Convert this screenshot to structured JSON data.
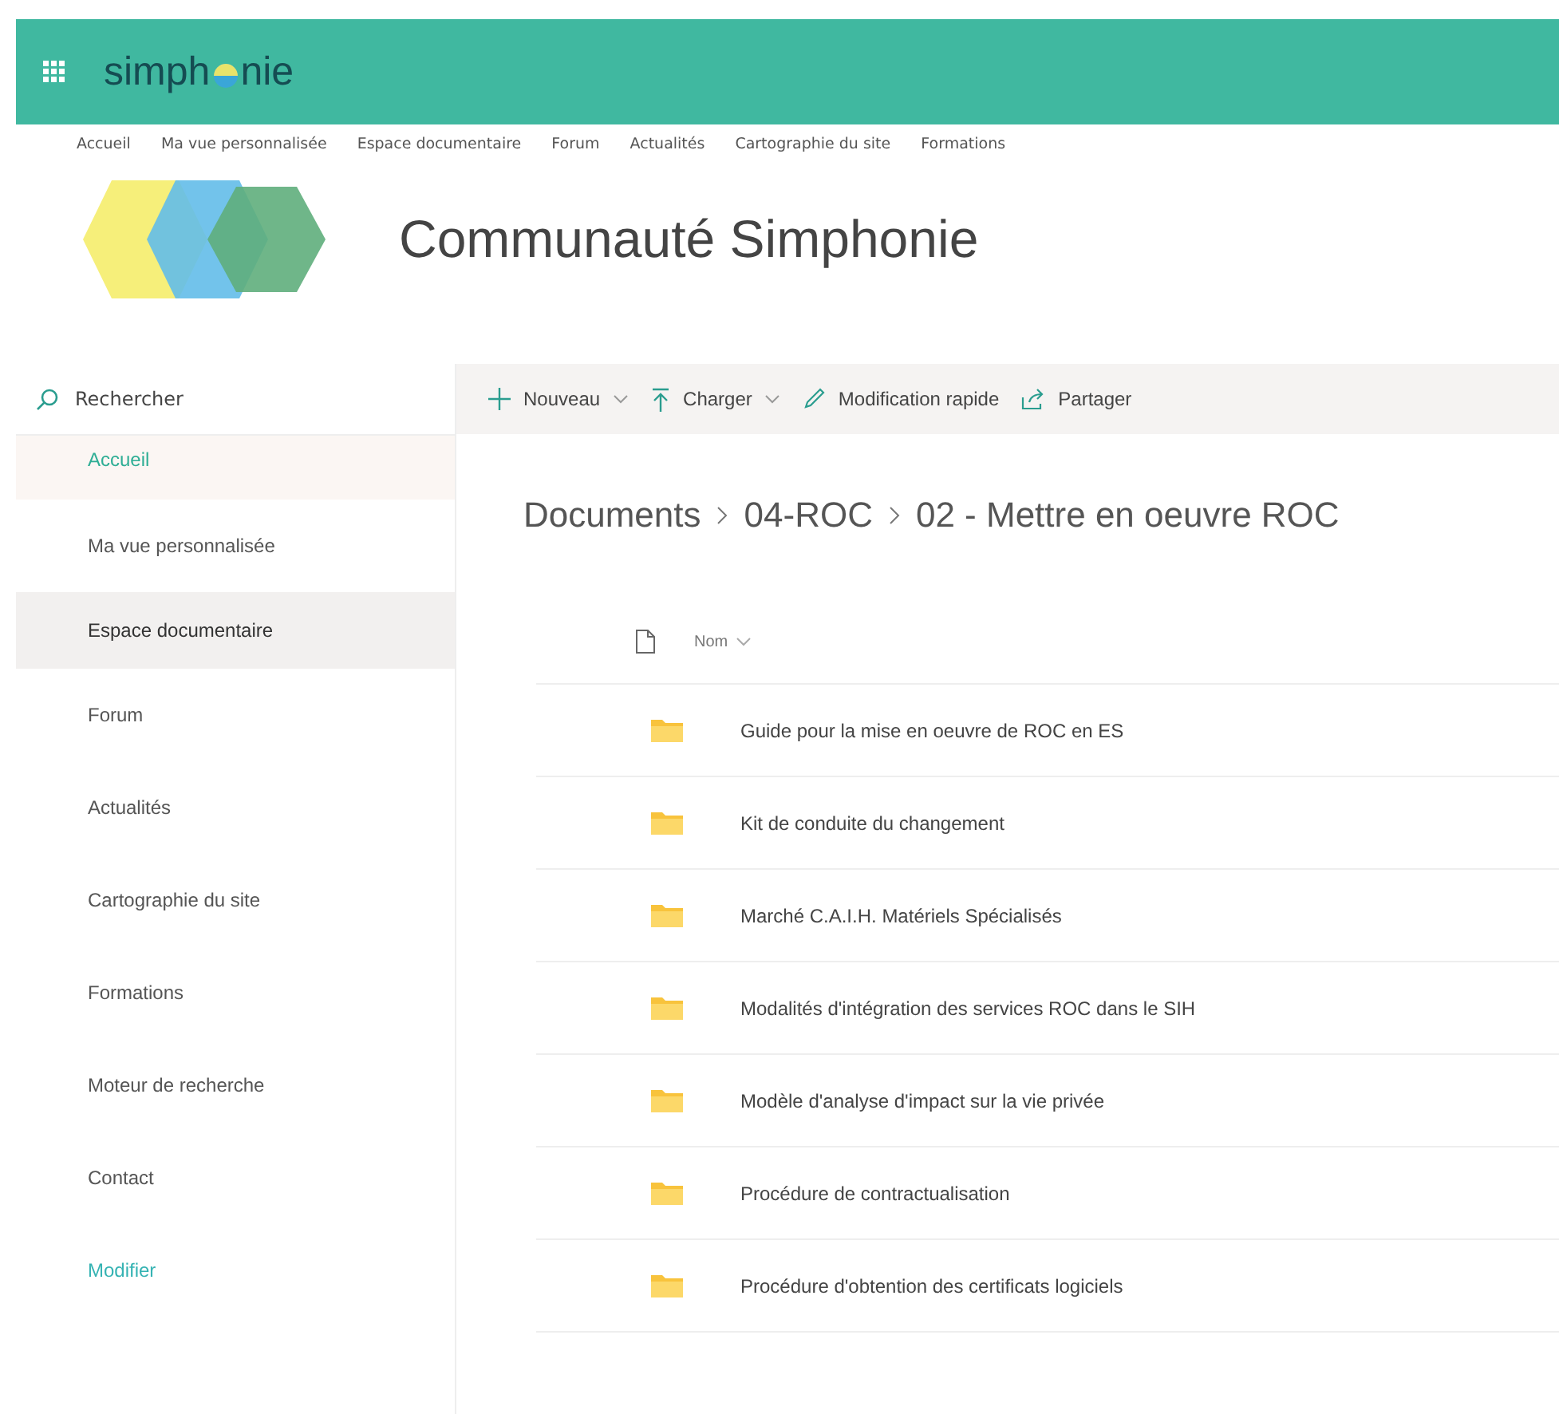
{
  "header": {
    "logo_parts": [
      "simph",
      "nie"
    ]
  },
  "top_nav": [
    "Accueil",
    "Ma vue personnalisée",
    "Espace documentaire",
    "Forum",
    "Actualités",
    "Cartographie du site",
    "Formations"
  ],
  "site": {
    "title": "Communauté Simphonie"
  },
  "search": {
    "placeholder": "Rechercher"
  },
  "sidebar": {
    "items": [
      {
        "label": "Accueil",
        "kind": "current",
        "selected": false
      },
      {
        "label": "Ma vue personnalisée",
        "kind": "item",
        "selected": false
      },
      {
        "label": "Espace documentaire",
        "kind": "item",
        "selected": true
      },
      {
        "label": "Forum",
        "kind": "item",
        "selected": false
      },
      {
        "label": "Actualités",
        "kind": "item",
        "selected": false
      },
      {
        "label": "Cartographie du site",
        "kind": "item",
        "selected": false
      },
      {
        "label": "Formations",
        "kind": "item",
        "selected": false
      },
      {
        "label": "Moteur de recherche",
        "kind": "item",
        "selected": false
      },
      {
        "label": "Contact",
        "kind": "item",
        "selected": false
      },
      {
        "label": "Modifier",
        "kind": "link",
        "selected": false
      }
    ]
  },
  "command_bar": [
    {
      "label": "Nouveau",
      "kind": "new",
      "dropdown": true
    },
    {
      "label": "Charger",
      "kind": "upload",
      "dropdown": true
    },
    {
      "label": "Modification rapide",
      "kind": "edit",
      "dropdown": false
    },
    {
      "label": "Partager",
      "kind": "share",
      "dropdown": false
    }
  ],
  "breadcrumb": [
    "Documents",
    "04-ROC",
    "02 - Mettre en oeuvre ROC"
  ],
  "table": {
    "columns": [
      {
        "label": "Nom",
        "sortable": true
      }
    ],
    "rows": [
      {
        "name": "Guide pour la mise en oeuvre de ROC en ES",
        "kind": "folder"
      },
      {
        "name": "Kit de conduite du changement",
        "kind": "folder"
      },
      {
        "name": "Marché C.A.I.H. Matériels Spécialisés",
        "kind": "folder"
      },
      {
        "name": "Modalités d'intégration des services ROC dans le SIH",
        "kind": "folder"
      },
      {
        "name": "Modèle d'analyse d'impact sur la vie privée",
        "kind": "folder"
      },
      {
        "name": "Procédure de contractualisation",
        "kind": "folder"
      },
      {
        "name": "Procédure d'obtention des certificats logiciels",
        "kind": "folder"
      }
    ]
  }
}
